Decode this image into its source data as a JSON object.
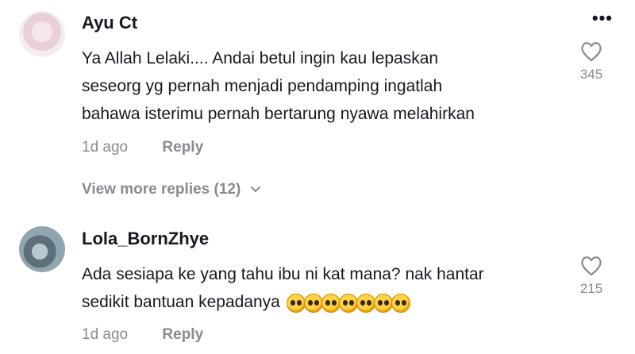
{
  "comments": [
    {
      "username": "Ayu Ct",
      "lines": [
        "Ya Allah Lelaki.... Andai betul ingin kau lepaskan",
        "seseorg yg pernah menjadi pendamping ingatlah",
        "bahawa isterimu pernah bertarung nyawa melahirkan"
      ],
      "time": "1d ago",
      "reply_label": "Reply",
      "likes": "345",
      "view_more": "View more replies (12)"
    },
    {
      "username": "Lola_BornZhye",
      "lines": [
        "Ada sesiapa ke yang tahu ibu ni kat mana? nak hantar",
        "sedikit bantuan kepadanya"
      ],
      "emoji_name": "pleading-face-emoji",
      "emoji_count": 7,
      "time": "1d ago",
      "reply_label": "Reply",
      "likes": "215"
    }
  ],
  "icons": {
    "more": "more-dots-icon",
    "like": "heart-outline-icon",
    "expand": "chevron-down-icon"
  },
  "colors": {
    "text": "#161823",
    "muted": "#8a8b91",
    "background": "#ffffff"
  }
}
